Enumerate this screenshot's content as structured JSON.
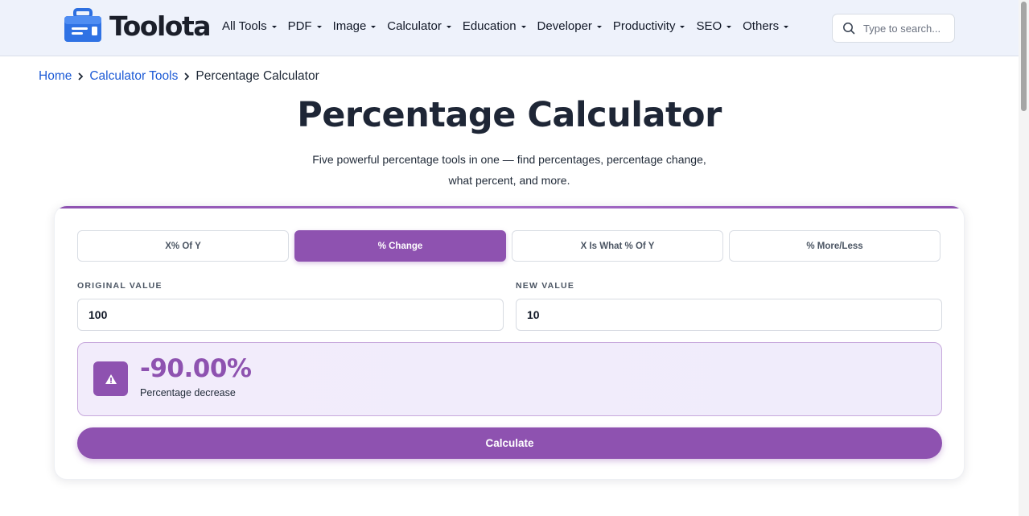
{
  "brand": {
    "name": "Toolota"
  },
  "nav": {
    "items": [
      {
        "label": "All Tools"
      },
      {
        "label": "PDF"
      },
      {
        "label": "Image"
      },
      {
        "label": "Calculator"
      },
      {
        "label": "Education"
      },
      {
        "label": "Developer"
      },
      {
        "label": "Productivity"
      },
      {
        "label": "SEO"
      },
      {
        "label": "Others"
      }
    ],
    "search_placeholder": "Type to search..."
  },
  "breadcrumb": {
    "home": "Home",
    "category": "Calculator Tools",
    "current": "Percentage Calculator"
  },
  "page": {
    "title": "Percentage Calculator",
    "subtitle": "Five powerful percentage tools in one — find percentages, percentage change, what percent, and more."
  },
  "calculator": {
    "tabs": [
      {
        "label": "X% Of Y",
        "active": false
      },
      {
        "label": "% Change",
        "active": true
      },
      {
        "label": "X Is What % Of Y",
        "active": false
      },
      {
        "label": "% More/Less",
        "active": false
      }
    ],
    "original_label": "ORIGINAL VALUE",
    "original_value": "100",
    "new_label": "NEW VALUE",
    "new_value": "10",
    "result_value": "-90.00%",
    "result_label": "Percentage decrease",
    "calculate_label": "Calculate"
  },
  "colors": {
    "accent": "#8e52b0",
    "link": "#1d5bd6",
    "header_bg": "#eef2fb",
    "result_bg": "#f2ecfb"
  },
  "icons": {
    "logo": "toolbox-icon",
    "search": "search-icon",
    "breadcrumb_separator": "chevron-right-icon",
    "result": "warning-triangle-icon",
    "nav_dropdown": "caret-down-icon"
  }
}
